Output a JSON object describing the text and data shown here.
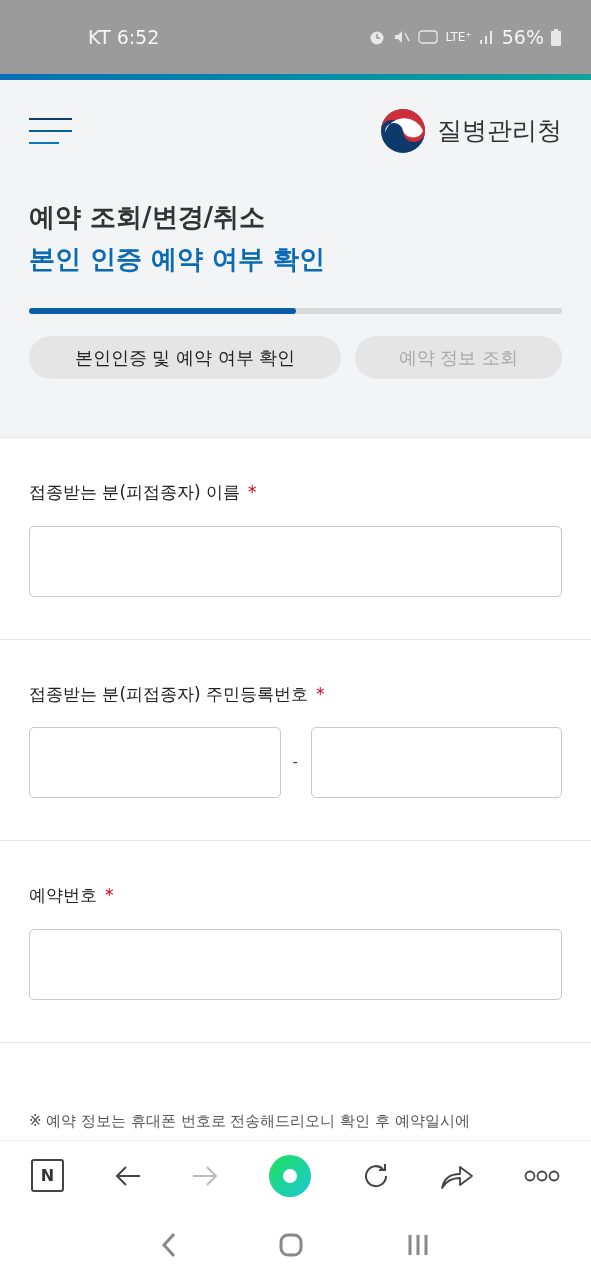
{
  "status_bar": {
    "carrier_time": "KT 6:52",
    "network": "LTE⁺",
    "battery": "56%"
  },
  "header": {
    "logo_text": "질병관리청"
  },
  "title": {
    "line1": "예약 조회/변경/취소",
    "line2": "본인 인증 예약 여부 확인"
  },
  "progress": {
    "level": 0.5
  },
  "steps": [
    {
      "label": "본인인증 및 예약 여부 확인",
      "selected": true
    },
    {
      "label": "예약 정보 조회",
      "selected": false
    }
  ],
  "fields": [
    {
      "kind": "single",
      "label": "접종받는 분(피접종자) 이름",
      "required": true
    },
    {
      "kind": "split",
      "label": "접종받는 분(피접종자) 주민등록번호",
      "required": true,
      "separator": "-"
    },
    {
      "kind": "single",
      "label": "예약번호",
      "required": true
    }
  ],
  "required_mark": "*",
  "notice": "※ 예약 정보는 휴대폰 번호로 전송해드리오니 확인 후 예약일시에",
  "browser_toolbar": {
    "n_label": "N"
  }
}
